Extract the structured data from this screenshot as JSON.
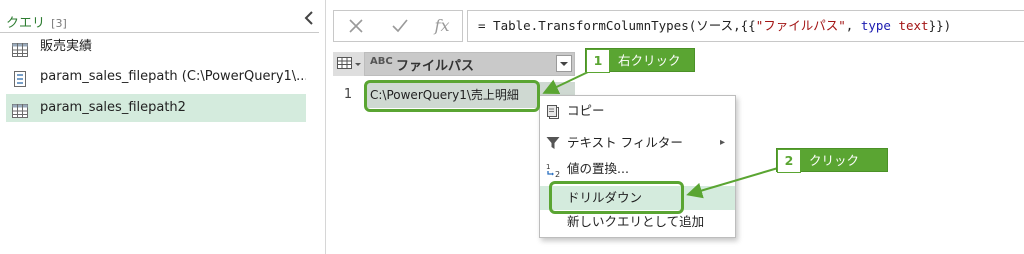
{
  "queries_pane": {
    "title": "クエリ",
    "count": "[3]",
    "collapse_icon": "chevron-left-icon",
    "items": [
      {
        "label": "販売実績",
        "icon": "table-icon"
      },
      {
        "label": "param_sales_filepath (C:\\PowerQuery1\\...",
        "icon": "parameter-icon"
      },
      {
        "label": "param_sales_filepath2",
        "icon": "table-icon",
        "selected": true
      }
    ]
  },
  "formula_bar": {
    "cancel_icon": "close-icon",
    "commit_icon": "checkmark-icon",
    "fx_label": "fx",
    "prefix": "= Table.TransformColumnTypes(ソース,{{",
    "string_token": "\"ファイルパス\"",
    "separator": ", ",
    "keyword": "type",
    "type_name": " text",
    "suffix": "}})"
  },
  "grid": {
    "column_type": "ABC",
    "column_header": "ファイルパス",
    "row_number": "1",
    "cell_value": "C:\\PowerQuery1\\売上明細"
  },
  "context_menu": {
    "items": [
      {
        "label": "コピー",
        "icon": "copy-icon"
      },
      {
        "label": "テキスト フィルター",
        "icon": "filter-icon",
        "has_submenu": true
      },
      {
        "label": "値の置換...",
        "icon": "replace-values-icon"
      },
      {
        "label": "ドリルダウン",
        "highlighted": true
      },
      {
        "label": "新しいクエリとして追加"
      }
    ]
  },
  "annotations": {
    "step1": {
      "number": "1",
      "text": "右クリック"
    },
    "step2": {
      "number": "2",
      "text": "クリック"
    },
    "accent": "#5aa532"
  },
  "colors": {
    "selection_bg": "#d4ebdd",
    "header_text": "#2e7d32"
  }
}
